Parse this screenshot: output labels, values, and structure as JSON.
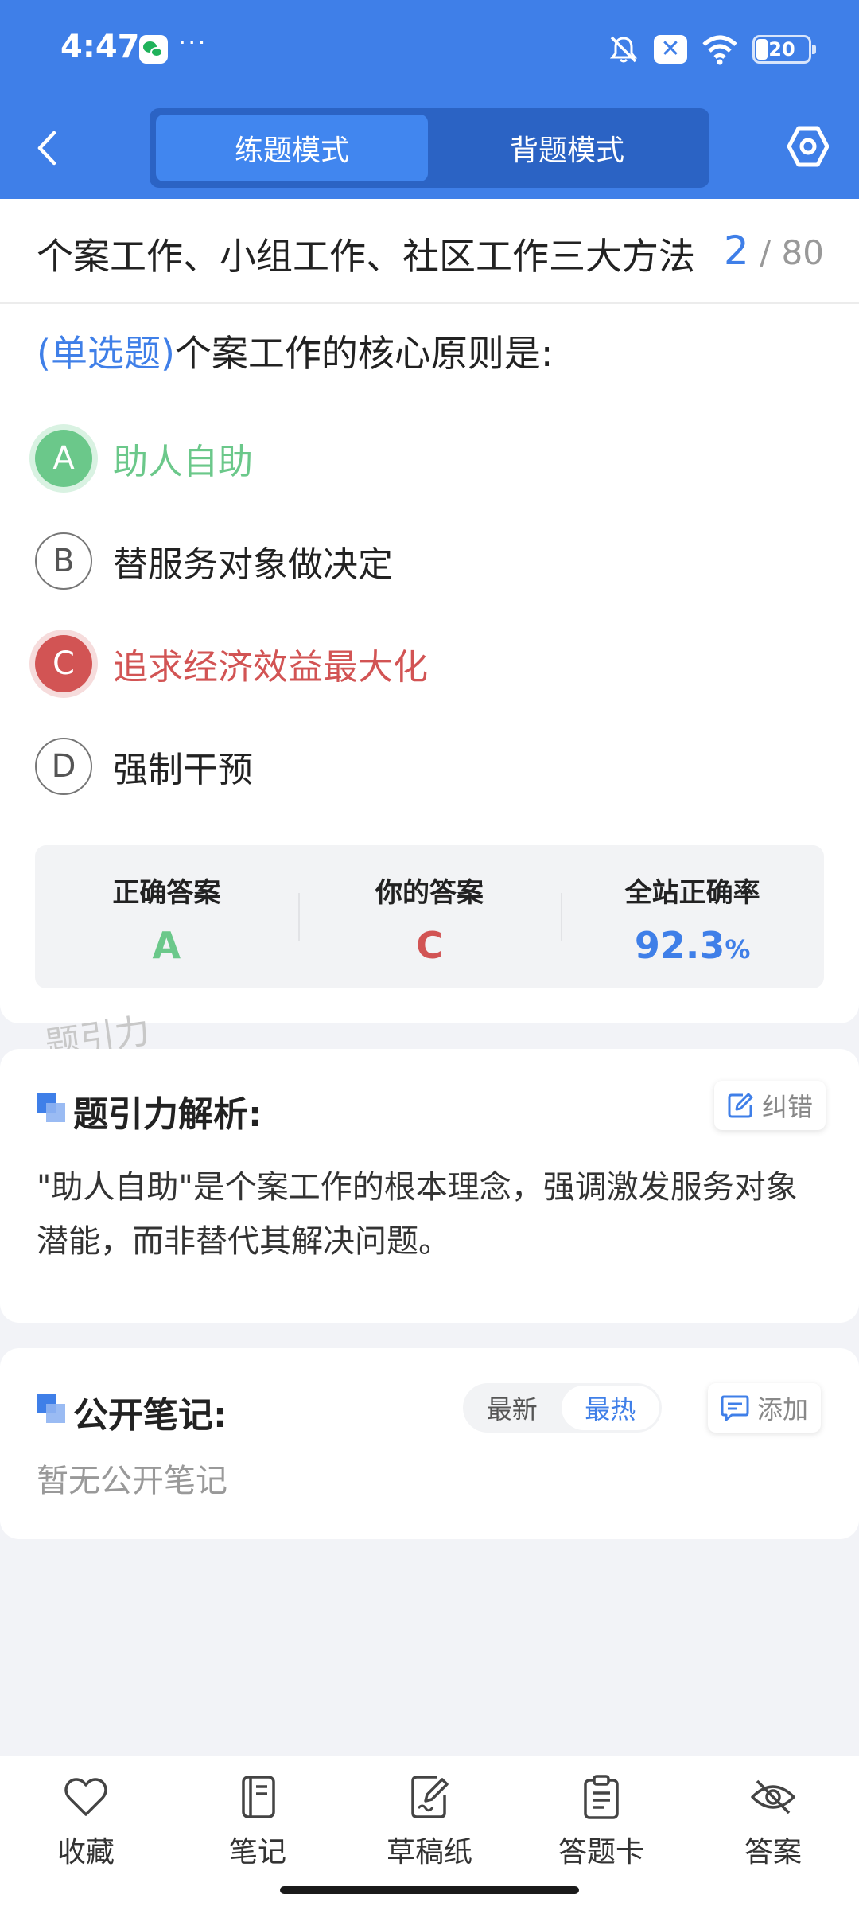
{
  "status_bar": {
    "time": "4:47",
    "dots": "···",
    "battery": "20",
    "icons": [
      "wechat-icon",
      "bell-off-icon",
      "close-box-icon",
      "wifi-icon",
      "battery-icon"
    ]
  },
  "header": {
    "mode_tabs": [
      "练题模式",
      "背题模式"
    ],
    "active_tab": "练题模式",
    "back_icon": "chevron-left-icon",
    "settings_icon": "hexagon-settings-icon"
  },
  "question": {
    "chapter_title": "个案工作、小组工作、社区工作三大方法",
    "current_index": "2",
    "total": "/ 80",
    "type_tag": "(单选题)",
    "text": "个案工作的核心原则是:",
    "options": [
      {
        "letter": "A",
        "text": "助人自助",
        "state": "correct"
      },
      {
        "letter": "B",
        "text": "替服务对象做决定",
        "state": "normal"
      },
      {
        "letter": "C",
        "text": "追求经济效益最大化",
        "state": "wrong"
      },
      {
        "letter": "D",
        "text": "强制干预",
        "state": "normal"
      }
    ]
  },
  "stats": {
    "correct_label": "正确答案",
    "correct_value": "A",
    "yours_label": "你的答案",
    "yours_value": "C",
    "rate_label": "全站正确率",
    "rate_value": "92.3",
    "rate_unit": "%"
  },
  "watermark": "题引力",
  "analysis": {
    "title": "题引力解析:",
    "report_label": "纠错",
    "text": "\"助人自助\"是个案工作的根本理念，强调激发服务对象潜能，而非替代其解决问题。"
  },
  "notes": {
    "title": "公开笔记:",
    "sort_latest": "最新",
    "sort_hot": "最热",
    "active_sort": "最热",
    "add_label": "添加",
    "empty_text": "暂无公开笔记"
  },
  "bottom_nav": [
    {
      "label": "收藏",
      "icon": "heart-icon"
    },
    {
      "label": "笔记",
      "icon": "notebook-icon"
    },
    {
      "label": "草稿纸",
      "icon": "draft-paper-icon"
    },
    {
      "label": "答题卡",
      "icon": "answer-sheet-icon"
    },
    {
      "label": "答案",
      "icon": "eye-off-icon"
    }
  ],
  "colors": {
    "primary": "#3f7fe8",
    "correct": "#6bc88a",
    "wrong": "#d25454"
  }
}
